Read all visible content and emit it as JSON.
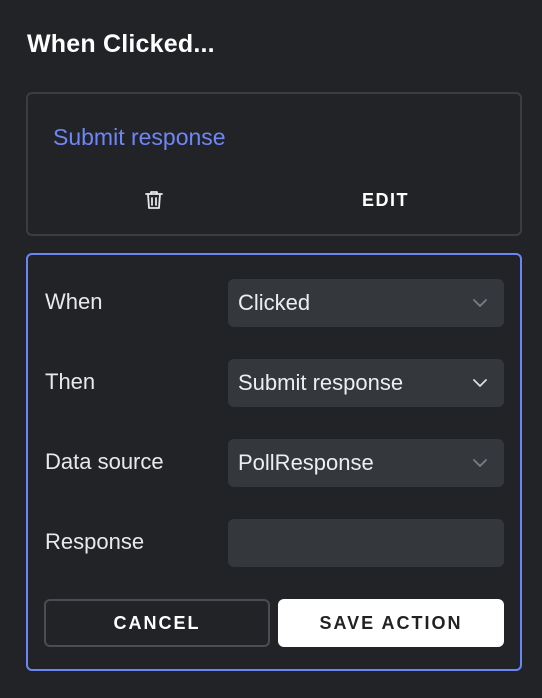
{
  "header": {
    "title": "When Clicked..."
  },
  "action": {
    "name": "Submit response",
    "delete_icon": "trash-icon",
    "edit_label": "EDIT"
  },
  "form": {
    "when": {
      "label": "When",
      "value": "Clicked",
      "icon": "chevron-down-icon"
    },
    "then": {
      "label": "Then",
      "value": "Submit response",
      "icon": "chevron-down-icon"
    },
    "data_source": {
      "label": "Data source",
      "value": "PollResponse",
      "icon": "chevron-down-icon"
    },
    "response": {
      "label": "Response",
      "value": "",
      "placeholder": ""
    },
    "cancel_label": "CANCEL",
    "save_label": "SAVE ACTION"
  },
  "colors": {
    "background": "#212326",
    "accent": "#6a86f5",
    "link": "#6f86f7",
    "field": "#34373c"
  }
}
